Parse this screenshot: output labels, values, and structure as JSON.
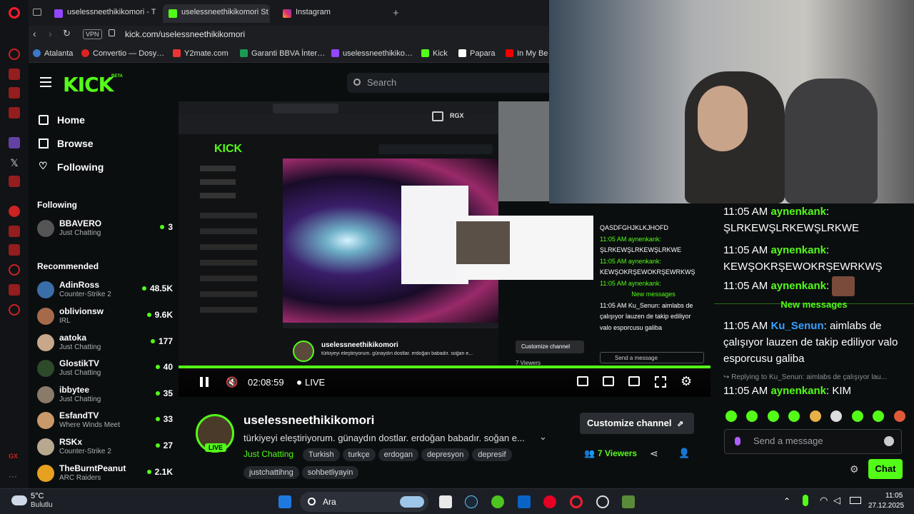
{
  "browser": {
    "tabs": [
      {
        "label": "uselessneethikikomori - T",
        "active": false
      },
      {
        "label": "uselessneethikikomori St",
        "active": true
      },
      {
        "label": "Instagram",
        "active": false
      }
    ],
    "vpn_label": "VPN",
    "url": "kick.com/uselessneethikikomori",
    "bookmarks": [
      "Atalanta",
      "Convertio — Dosy…",
      "Y2mate.com",
      "Garanti BBVA İnter…",
      "uselessneethikiko…",
      "Kick",
      "Papara",
      "In My Be"
    ]
  },
  "kick": {
    "logo": "KICK",
    "logo_badge": "BETA",
    "search_placeholder": "Search"
  },
  "sidebar": {
    "nav": [
      "Home",
      "Browse",
      "Following"
    ],
    "following_title": "Following",
    "following": [
      {
        "name": "BBAVERO",
        "category": "Just Chatting",
        "viewers": "3"
      }
    ],
    "recommended_title": "Recommended",
    "recommended": [
      {
        "name": "AdinRoss",
        "category": "Counter-Strike 2",
        "viewers": "48.5K"
      },
      {
        "name": "oblivionsw",
        "category": "IRL",
        "viewers": "9.6K"
      },
      {
        "name": "aatoka",
        "category": "Just Chatting",
        "viewers": "177"
      },
      {
        "name": "GlostikTV",
        "category": "Just Chatting",
        "viewers": "40"
      },
      {
        "name": "ibbytee",
        "category": "Just Chatting",
        "viewers": "35"
      },
      {
        "name": "EsfandTV",
        "category": "Where Winds Meet",
        "viewers": "33"
      },
      {
        "name": "RSKx",
        "category": "Counter-Strike 2",
        "viewers": "27"
      },
      {
        "name": "TheBurntPeanut",
        "category": "ARC Raiders",
        "viewers": "2.1K"
      }
    ]
  },
  "player": {
    "time": "02:08:59",
    "live": "LIVE"
  },
  "inner_stream": {
    "rgx_label": "RGX",
    "chat_lines": [
      "QASDFGHJKLKJHOFD",
      "11:05 AM aynenkank:",
      "ŞLRKEWŞLRKEWŞLRKWE",
      "11:05 AM aynenkank:",
      "KEWŞOKRŞEWOKRŞEWRKWŞ",
      "11:05 AM aynenkank:",
      "New messages",
      "11:05 AM Ku_Senun: aimlabs de",
      "çalışıyor lauzen de takip ediliyor",
      "valo esporcusu galiba"
    ],
    "send_placeholder": "Send a message",
    "customize": "Customize channel",
    "viewers": "7 Viewers",
    "username": "uselessneethikikomori",
    "title": "türkiyeyi eleştiriyorum. günaydın dostlar. erdoğan babadır. soğan e..."
  },
  "channel": {
    "username": "uselessneethikikomori",
    "live_badge": "LIVE",
    "title": "türkiyeyi eleştiriyorum. günaydın dostlar. erdoğan babadır. soğan e...",
    "category": "Just Chatting",
    "tags": [
      "Turkish",
      "turkçe",
      "erdogan",
      "depresyon",
      "depresif",
      "justchattihng",
      "sohbetliyayin"
    ],
    "customize_label": "Customize channel",
    "viewers": "7 Viewers"
  },
  "chat": {
    "messages": [
      {
        "time": "11:05 AM",
        "user": "aynenkank",
        "text": "ŞLRKEWŞLRKEWŞLRKWE"
      },
      {
        "time": "11:05 AM",
        "user": "aynenkank",
        "text": "KEWŞOKRŞEWOKRŞEWRKWŞ"
      },
      {
        "time": "11:05 AM",
        "user": "aynenkank",
        "text": ""
      },
      {
        "time": "11:05 AM",
        "user": "Ku_Senun",
        "text": "aimlabs de çalışıyor lauzen de takip ediliyor valo esporcusu galiba"
      },
      {
        "time": "11:05 AM",
        "user": "aynenkank",
        "text": "KIM"
      }
    ],
    "new_messages": "New messages",
    "reply_context": "Replying to Ku_Senun: aimlabs de çalışıyor lau...",
    "input_placeholder": "Send a message",
    "send_button": "Chat"
  },
  "taskbar": {
    "weather_temp": "5°C",
    "weather_desc": "Bulutlu",
    "search_label": "Ara",
    "time": "11:05",
    "date": "27.12.2025"
  },
  "colors": {
    "kick_green": "#53fc18",
    "background": "#0b0e0f",
    "link_blue": "#3aa0ff"
  }
}
